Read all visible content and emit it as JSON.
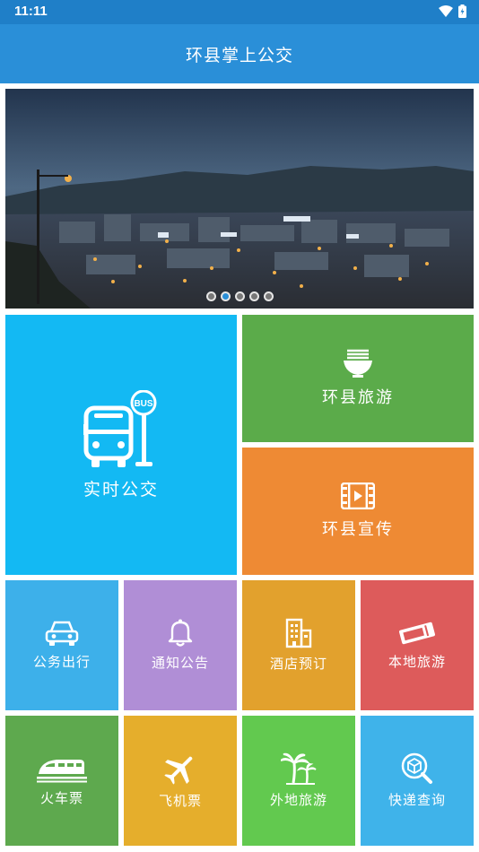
{
  "status_bar": {
    "time": "11:11"
  },
  "app_bar": {
    "title": "环县掌上公交"
  },
  "banner": {
    "slide_count": 5,
    "active_index": 1
  },
  "tiles": {
    "realtime_bus": {
      "label": "实时公交",
      "badge": "BUS",
      "color": "#13b9f3",
      "icon": "bus-stop-icon"
    },
    "tourism": {
      "label": "环县旅游",
      "color": "#5bab4a",
      "icon": "noodle-bowl-icon"
    },
    "promo": {
      "label": "环县宣传",
      "color": "#ee8a34",
      "icon": "film-icon"
    },
    "official": {
      "label": "公务出行",
      "color": "#3db0ea",
      "icon": "car-icon"
    },
    "notice": {
      "label": "通知公告",
      "color": "#b08ed6",
      "icon": "bell-icon"
    },
    "hotel": {
      "label": "酒店预订",
      "color": "#e2a12d",
      "icon": "building-icon"
    },
    "local_tour": {
      "label": "本地旅游",
      "color": "#dd5b5b",
      "icon": "ticket-icon"
    },
    "train": {
      "label": "火车票",
      "color": "#5ea94e",
      "icon": "train-icon"
    },
    "flight": {
      "label": "飞机票",
      "color": "#e5ae2c",
      "icon": "airplane-icon"
    },
    "outside_tour": {
      "label": "外地旅游",
      "color": "#62c94f",
      "icon": "palm-tree-icon"
    },
    "express": {
      "label": "快递查询",
      "color": "#3fb3ea",
      "icon": "package-search-icon"
    }
  }
}
